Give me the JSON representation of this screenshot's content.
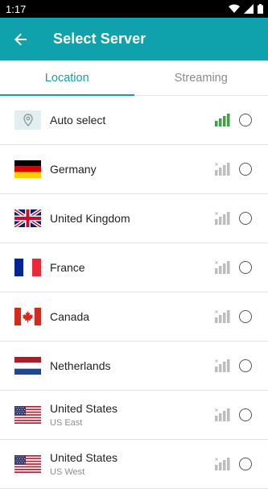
{
  "status_bar": {
    "time": "1:17"
  },
  "appbar": {
    "title": "Select Server"
  },
  "tabs": [
    {
      "label": "Location",
      "active": true
    },
    {
      "label": "Streaming",
      "active": false
    }
  ],
  "servers": [
    {
      "name": "Auto select",
      "subtitle": "",
      "flag": "location-pin-icon",
      "signal": "strong-green"
    },
    {
      "name": "Germany",
      "subtitle": "",
      "flag": "flag-germany",
      "signal": "unknown-gray"
    },
    {
      "name": "United Kingdom",
      "subtitle": "",
      "flag": "flag-united-kingdom",
      "signal": "unknown-gray"
    },
    {
      "name": "France",
      "subtitle": "",
      "flag": "flag-france",
      "signal": "unknown-gray"
    },
    {
      "name": "Canada",
      "subtitle": "",
      "flag": "flag-canada",
      "signal": "unknown-gray"
    },
    {
      "name": "Netherlands",
      "subtitle": "",
      "flag": "flag-netherlands",
      "signal": "unknown-gray"
    },
    {
      "name": "United States",
      "subtitle": "US East",
      "flag": "flag-united-states",
      "signal": "unknown-gray"
    },
    {
      "name": "United States",
      "subtitle": "US West",
      "flag": "flag-united-states",
      "signal": "unknown-gray"
    }
  ],
  "colors": {
    "accent": "#0fa1ac",
    "signal_good": "#43a047",
    "signal_unknown": "#bdbdbd"
  }
}
